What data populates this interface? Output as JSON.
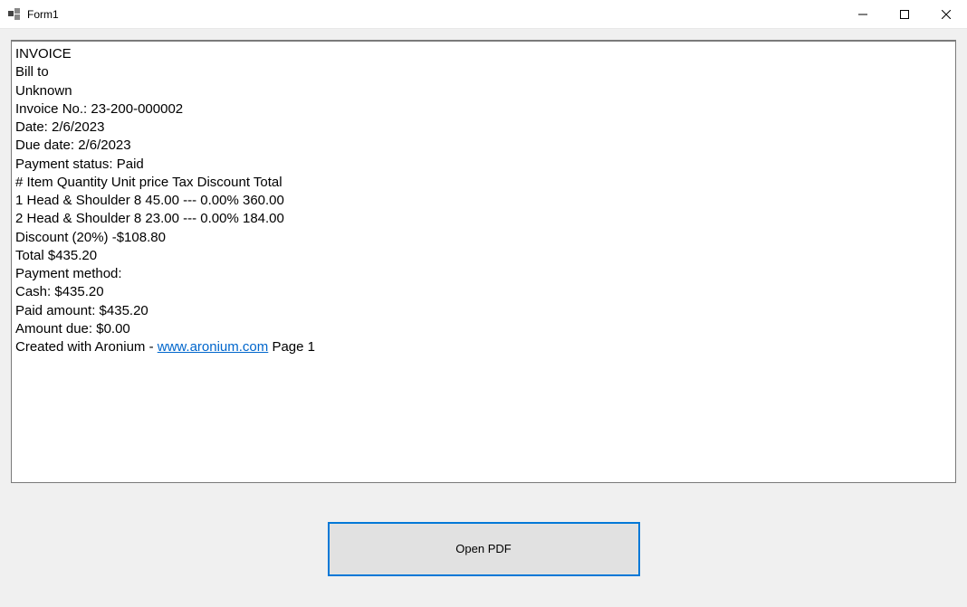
{
  "window": {
    "title": "Form1"
  },
  "invoice": {
    "header": "INVOICE",
    "bill_to_label": "Bill to",
    "bill_to_name": "Unknown",
    "invoice_no_line": "Invoice No.: 23-200-000002",
    "date_line": "Date: 2/6/2023",
    "due_date_line": "Due date: 2/6/2023",
    "payment_status_line": "Payment status: Paid",
    "table_header": "# Item Quantity Unit price Tax Discount Total",
    "row1": "1 Head & Shoulder 8 45.00 --- 0.00% 360.00",
    "row2": "2 Head & Shoulder 8 23.00 --- 0.00% 184.00",
    "discount_line": "Discount (20%) -$108.80",
    "total_line": "Total $435.20",
    "payment_method_line": "Payment method:",
    "cash_line": "Cash: $435.20",
    "paid_amount_line": "Paid amount: $435.20",
    "amount_due_line": "Amount due: $0.00",
    "footer_prefix": "Created with Aronium - ",
    "footer_link": "www.aronium.com",
    "footer_suffix": " Page 1"
  },
  "buttons": {
    "open_pdf": "Open PDF"
  }
}
